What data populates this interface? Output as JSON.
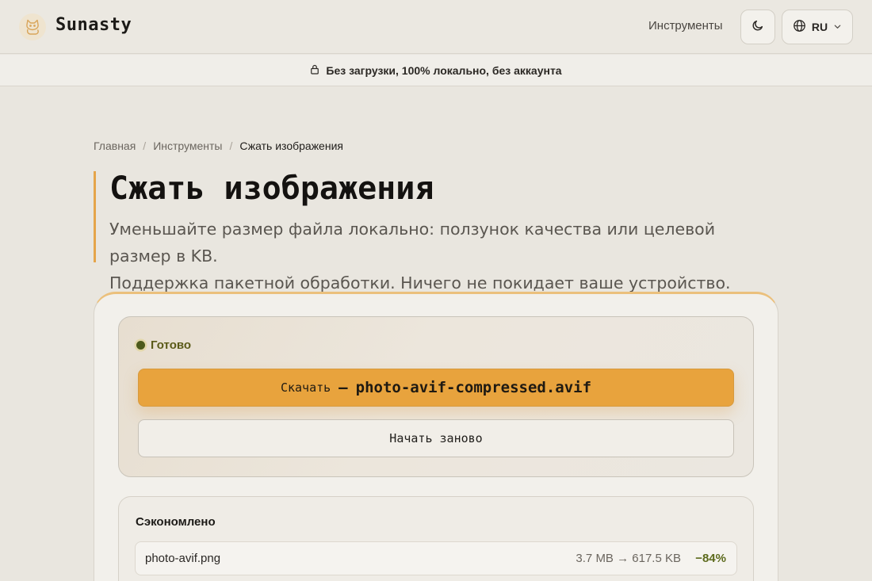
{
  "header": {
    "brand": "Sunasty",
    "logo_icon": "cat-logo-icon",
    "nav_tools": "Инструменты",
    "theme_icon": "moon-icon",
    "lang_icon": "globe-icon",
    "lang": "RU",
    "lang_chevron_icon": "chevron-down-icon"
  },
  "banner": {
    "icon": "lock-icon",
    "text": "Без загрузки, 100% локально, без аккаунта"
  },
  "breadcrumb": {
    "items": [
      "Главная",
      "Инструменты",
      "Сжать изображения"
    ],
    "separator": "/"
  },
  "page": {
    "title": "Сжать изображения",
    "subtitle_line1": "Уменьшайте размер файла локально: ползунок качества или целевой размер в KB.",
    "subtitle_line2": "Поддержка пакетной обработки. Ничего не покидает ваше устройство."
  },
  "result": {
    "status": "Готово",
    "download_label": "Скачать",
    "download_dash": "—",
    "download_filename": "photo-avif-compressed.avif",
    "restart_label": "Начать заново"
  },
  "savings": {
    "title": "Сэкономлено",
    "files": [
      {
        "name": "photo-avif.png",
        "sizes": "3.7 MB → 617.5 KB",
        "saving": "−84%"
      }
    ]
  },
  "colors": {
    "accent": "#e8a33d",
    "status_dot": "#4d5a1c",
    "saving_text": "#5c6a1c"
  }
}
